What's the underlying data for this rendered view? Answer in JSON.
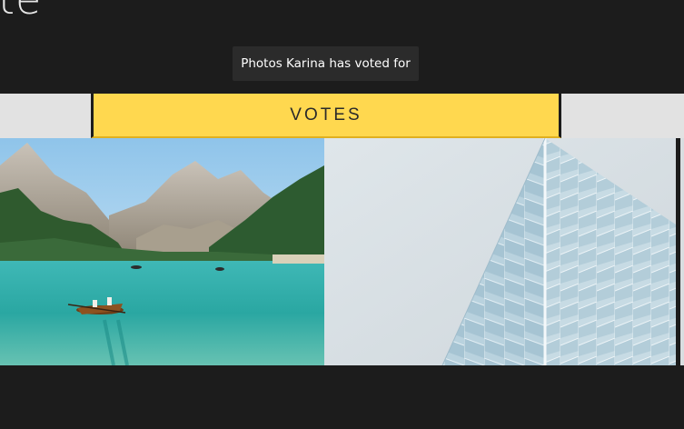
{
  "header": {
    "title_fragment": "te"
  },
  "tooltip": {
    "text": "Photos Karina has voted for"
  },
  "tabs": {
    "active_label": "VOTES",
    "accent_color": "#ffd84f"
  },
  "gallery": {
    "photos": [
      {
        "subject": "lake-with-rowboat-photo"
      },
      {
        "subject": "glass-building-facade-photo"
      }
    ]
  }
}
